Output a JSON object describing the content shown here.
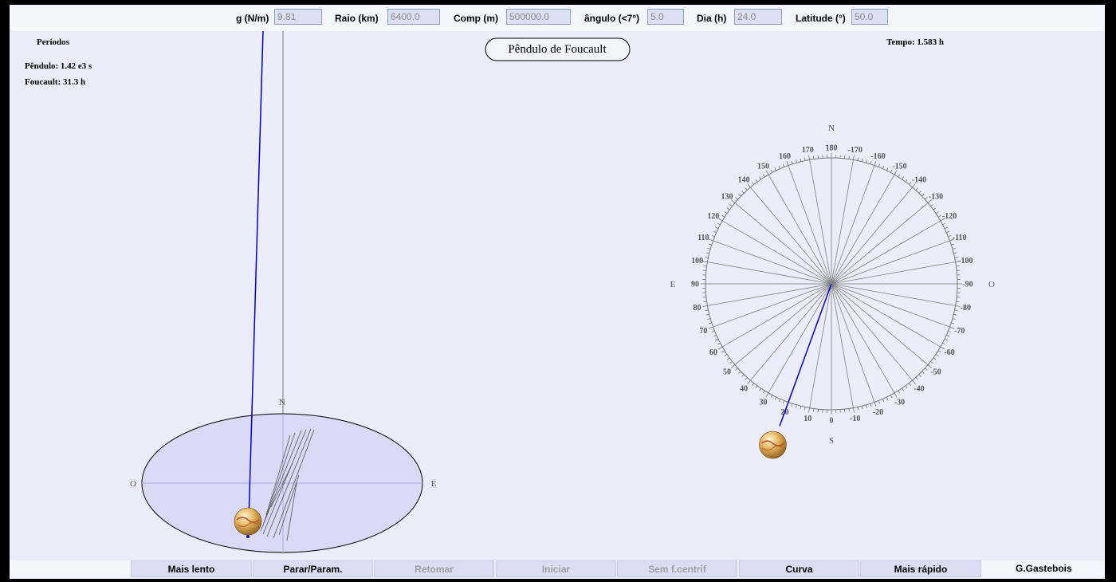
{
  "params": [
    {
      "label": "g (N/m)",
      "value": "9.81"
    },
    {
      "label": "Raio (km)",
      "value": "6400.0"
    },
    {
      "label": "Comp (m)",
      "value": "500000.0"
    },
    {
      "label": "ângulo (<7°)",
      "value": "5.0"
    },
    {
      "label": "Dia (h)",
      "value": "24.0"
    },
    {
      "label": "Latitude (°)",
      "value": "50.0"
    }
  ],
  "title": "Pêndulo de Foucault",
  "periods": {
    "heading": "Períodos",
    "pendulum": "Pêndulo: 1.42 e3 s",
    "foucault": "Foucault: 31.3 h"
  },
  "time_label": "Tempo: 1.583 h",
  "side_view": {
    "north": "N",
    "west": "O",
    "east": "E"
  },
  "dial": {
    "north": "N",
    "south": "S",
    "east": "E",
    "west": "O",
    "labels": [
      "0",
      "10",
      "20",
      "30",
      "40",
      "50",
      "60",
      "70",
      "80",
      "90",
      "100",
      "110",
      "120",
      "130",
      "140",
      "150",
      "160",
      "170",
      "180",
      "-170",
      "-160",
      "-150",
      "-140",
      "-130",
      "-120",
      "-110",
      "-100",
      "-90",
      "-80",
      "-70",
      "-60",
      "-50",
      "-40",
      "-30",
      "-20",
      "-10"
    ],
    "pendulum_angle_deg": 20
  },
  "buttons": [
    {
      "label": "Mais lento",
      "enabled": true
    },
    {
      "label": "Parar/Param.",
      "enabled": true
    },
    {
      "label": "Retomar",
      "enabled": false
    },
    {
      "label": "Iniciar",
      "enabled": false
    },
    {
      "label": "Sem f.centrif",
      "enabled": false
    },
    {
      "label": "Curva",
      "enabled": true
    },
    {
      "label": "Mais rápido",
      "enabled": true
    }
  ],
  "author": "G.Gastebois",
  "colors": {
    "string": "#0000cc",
    "ellipse_fill": "#dadaf6",
    "background": "#ececfb"
  }
}
